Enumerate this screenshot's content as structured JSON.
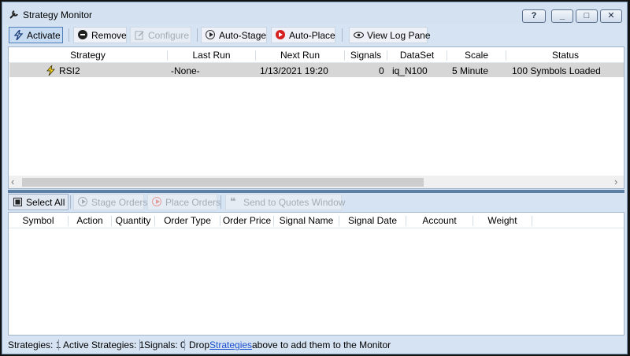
{
  "window": {
    "title": "Strategy Monitor"
  },
  "title_buttons": {
    "help": "?",
    "minimize": "_",
    "maximize": "□",
    "close": "✕"
  },
  "toolbar": {
    "activate": "Activate",
    "remove": "Remove",
    "configure": "Configure",
    "auto_stage": "Auto-Stage",
    "auto_place": "Auto-Place",
    "view_log": "View Log Pane"
  },
  "strategies_grid": {
    "columns": [
      "Strategy",
      "Last Run",
      "Next Run",
      "Signals",
      "DataSet",
      "Scale",
      "Status"
    ],
    "rows": [
      {
        "strategy": "RSI2",
        "last_run": "-None-",
        "next_run": "1/13/2021 19:20",
        "signals": "0",
        "dataset": "iq_N100",
        "scale": "5 Minute",
        "status": "100 Symbols Loaded"
      }
    ],
    "scroll_left": "‹",
    "scroll_right": "›"
  },
  "orders_toolbar": {
    "select_all": "Select All",
    "stage_orders": "Stage Orders",
    "place_orders": "Place Orders",
    "send_quotes": "Send to Quotes Window"
  },
  "orders_grid": {
    "columns": [
      "Symbol",
      "Action",
      "Quantity",
      "Order Type",
      "Order Price",
      "Signal Name",
      "Signal Date",
      "Account",
      "Weight"
    ]
  },
  "status_bar": {
    "strategies": "Strategies: 1",
    "active_strategies": "Active Strategies: 1",
    "signals": "Signals: 0",
    "drop_prefix": "Drop",
    "drop_link": "Strategies",
    "drop_suffix": "above to add them to the Monitor"
  },
  "colors": {
    "accent": "#4f7fb8",
    "splitter": "#5c7fa6",
    "selected_row": "#d6d6d6",
    "link": "#1a4fd0"
  }
}
